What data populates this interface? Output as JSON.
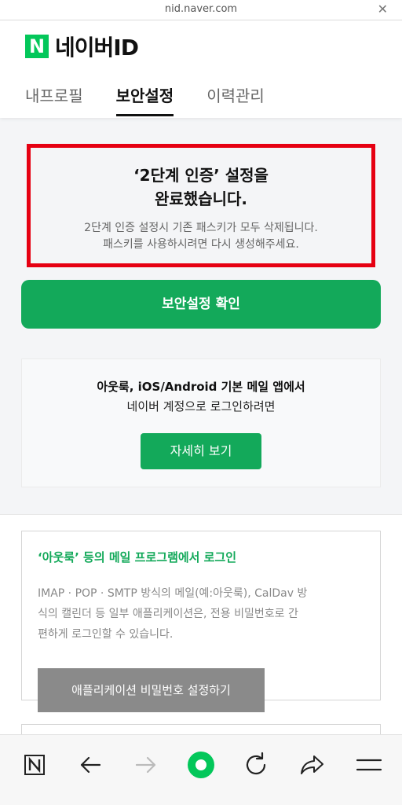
{
  "browser": {
    "url": "nid.naver.com",
    "close_icon": "close-icon"
  },
  "header": {
    "logo_mark": "N",
    "logo_text": "네이버ID",
    "tabs": [
      {
        "label": "내프로필",
        "active": false
      },
      {
        "label": "보안설정",
        "active": true
      },
      {
        "label": "이력관리",
        "active": false
      }
    ]
  },
  "alert": {
    "title_line1": "‘2단계 인증’ 설정을",
    "title_line2": "완료했습니다.",
    "desc_line1": "2단계 인증 설정시 기존 패스키가 모두 삭제됩니다.",
    "desc_line2": "패스키를 사용하시려면 다시 생성해주세요."
  },
  "confirm_button": "보안설정 확인",
  "mail_card": {
    "line1": "아웃룩, iOS/Android 기본 메일 앱에서",
    "line2": "네이버 계정으로 로그인하려면",
    "button": "자세히 보기"
  },
  "app_password": {
    "title": "‘아웃룩’ 등의 메일 프로그램에서 로그인",
    "desc_line1": "IMAP · POP · SMTP 방식의 메일(예:아웃룩), CalDav 방",
    "desc_line2": "식의 캘린더 등 일부 애플리케이션은, 전용 비밀번호로 간",
    "desc_line3": "편하게 로그인할 수 있습니다.",
    "button": "애플리케이션 비밀번호 설정하기"
  },
  "toolbar": {
    "icons": [
      "naver-n-icon",
      "back-arrow-icon",
      "forward-arrow-icon",
      "home-circle-icon",
      "refresh-icon",
      "share-icon",
      "menu-icon"
    ]
  },
  "colors": {
    "brand_green": "#03c75a",
    "button_green": "#13a95a",
    "highlight_red": "#e60012",
    "gray_button": "#8a8a8a"
  }
}
